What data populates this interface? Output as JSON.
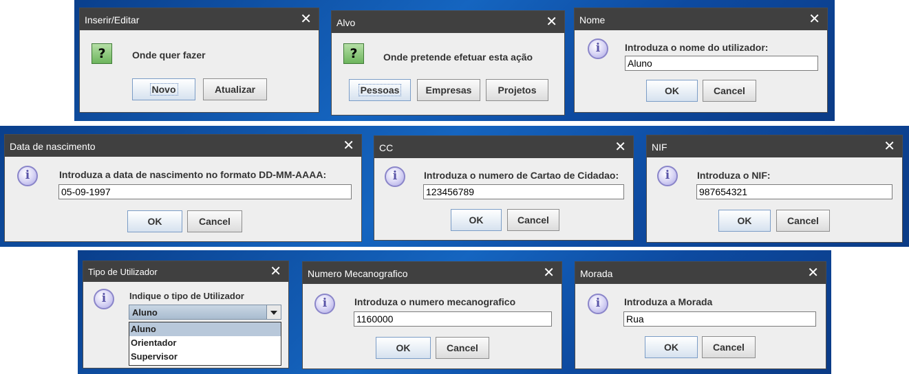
{
  "dialogs": {
    "inserir": {
      "title": "Inserir/Editar",
      "close": "✕",
      "icon": "question-icon",
      "icon_glyph": "?",
      "message": "Onde quer fazer",
      "buttons": [
        "Novo",
        "Atualizar"
      ]
    },
    "alvo": {
      "title": "Alvo",
      "close": "✕",
      "icon": "question-icon",
      "icon_glyph": "?",
      "message": "Onde pretende efetuar esta ação",
      "buttons": [
        "Pessoas",
        "Empresas",
        "Projetos"
      ]
    },
    "nome": {
      "title": "Nome",
      "close": "✕",
      "icon": "info-icon",
      "icon_glyph": "i",
      "message": "Introduza o nome do utilizador:",
      "value": "Aluno",
      "ok": "OK",
      "cancel": "Cancel"
    },
    "data": {
      "title": "Data de nascimento",
      "close": "✕",
      "icon": "info-icon",
      "icon_glyph": "i",
      "message": "Introduza a data de nascimento no formato DD-MM-AAAA:",
      "value": "05-09-1997",
      "ok": "OK",
      "cancel": "Cancel"
    },
    "cc": {
      "title": "CC",
      "close": "✕",
      "icon": "info-icon",
      "icon_glyph": "i",
      "message": "Introduza o numero de Cartao de Cidadao:",
      "value": "123456789",
      "ok": "OK",
      "cancel": "Cancel"
    },
    "nif": {
      "title": "NIF",
      "close": "✕",
      "icon": "info-icon",
      "icon_glyph": "i",
      "message": "Introduza o NIF:",
      "value": "987654321",
      "ok": "OK",
      "cancel": "Cancel"
    },
    "tipo": {
      "title": "Tipo de Utilizador",
      "close": "✕",
      "icon": "info-icon",
      "icon_glyph": "i",
      "message": "Indique o tipo de Utilizador",
      "selected": "Aluno",
      "options": [
        "Aluno",
        "Orientador",
        "Supervisor"
      ]
    },
    "numero": {
      "title": "Numero Mecanografico",
      "close": "✕",
      "icon": "info-icon",
      "icon_glyph": "i",
      "message": "Introduza o numero mecanografico",
      "value": "1160000",
      "ok": "OK",
      "cancel": "Cancel"
    },
    "morada": {
      "title": "Morada",
      "close": "✕",
      "icon": "info-icon",
      "icon_glyph": "i",
      "message": "Introduza a Morada",
      "value": "Rua",
      "ok": "OK",
      "cancel": "Cancel"
    }
  },
  "colors": {
    "titlebar": "#404040",
    "dialog_bg": "#eeeeee",
    "desktop": "#1565c0"
  }
}
